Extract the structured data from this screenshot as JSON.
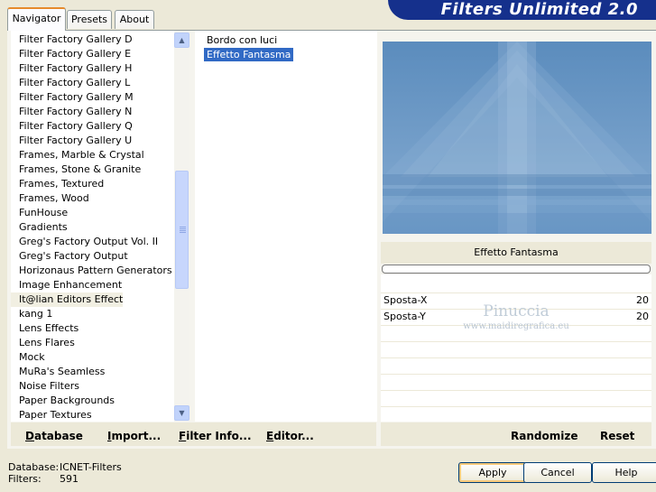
{
  "tabs": [
    {
      "label": "Navigator",
      "active": true
    },
    {
      "label": "Presets",
      "active": false
    },
    {
      "label": "About",
      "active": false
    }
  ],
  "banner_title": "Filters Unlimited 2.0",
  "categories": [
    "Filter Factory Gallery D",
    "Filter Factory Gallery E",
    "Filter Factory Gallery H",
    "Filter Factory Gallery L",
    "Filter Factory Gallery M",
    "Filter Factory Gallery N",
    "Filter Factory Gallery Q",
    "Filter Factory Gallery U",
    "Frames, Marble & Crystal",
    "Frames, Stone & Granite",
    "Frames, Textured",
    "Frames, Wood",
    "FunHouse",
    "Gradients",
    "Greg's Factory Output Vol. II",
    "Greg's Factory Output",
    "Horizonaus Pattern Generators",
    "Image Enhancement",
    "It@lian Editors Effect",
    "kang 1",
    "Lens Effects",
    "Lens Flares",
    "Mock",
    "MuRa's Seamless",
    "Noise Filters",
    "Paper Backgrounds",
    "Paper Textures"
  ],
  "selected_category": "It@lian Editors Effect",
  "filters": [
    "Bordo con luci",
    "Effetto Fantasma"
  ],
  "selected_filter": "Effetto Fantasma",
  "filter_name_display": "Effetto Fantasma",
  "params": [
    {
      "label": "Sposta-X",
      "value": "20"
    },
    {
      "label": "Sposta-Y",
      "value": "20"
    }
  ],
  "watermark": {
    "line1": "Pinuccia",
    "line2": "www.maidiregrafica.eu"
  },
  "left_buttons": [
    {
      "label": "Database",
      "underline": "D",
      "rest": "atabase"
    },
    {
      "label": "Import...",
      "underline": "I",
      "rest": "mport..."
    },
    {
      "label": "Filter Info...",
      "underline": "F",
      "rest": "ilter Info..."
    },
    {
      "label": "Editor...",
      "underline": "E",
      "rest": "ditor..."
    }
  ],
  "right_buttons": {
    "randomize": "Randomize",
    "reset": "Reset"
  },
  "status": {
    "database_label": "Database:",
    "database_value": "ICNET-Filters",
    "filters_label": "Filters:",
    "filters_value": "591"
  },
  "dialog_buttons": {
    "apply": "Apply",
    "cancel": "Cancel",
    "help": "Help"
  },
  "colors": {
    "banner": "#15308c",
    "selection": "#316ac5",
    "preview_base": "#5f8fbf",
    "window": "#ece9d8"
  }
}
